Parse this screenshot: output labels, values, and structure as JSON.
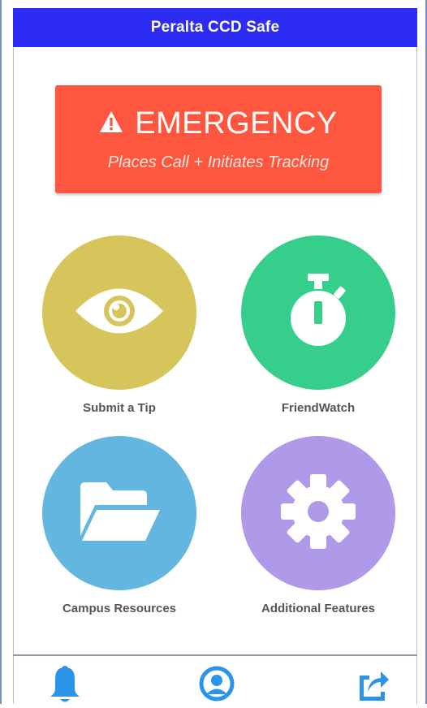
{
  "header": {
    "title": "Peralta CCD Safe"
  },
  "emergency": {
    "title": "EMERGENCY",
    "subtitle": "Places Call + Initiates Tracking",
    "icon": "warning-triangle-icon",
    "color": "#ff573f"
  },
  "tiles": [
    {
      "label": "Submit a Tip",
      "icon": "eye-icon",
      "color": "#d6c55a"
    },
    {
      "label": "FriendWatch",
      "icon": "stopwatch-icon",
      "color": "#35cf8b"
    },
    {
      "label": "Campus Resources",
      "icon": "folder-open-icon",
      "color": "#62b6e0"
    },
    {
      "label": "Additional Features",
      "icon": "gear-icon",
      "color": "#ae9ae8"
    }
  ],
  "bottom_nav": [
    {
      "icon": "bell-icon"
    },
    {
      "icon": "profile-icon"
    },
    {
      "icon": "share-icon"
    }
  ],
  "colors": {
    "header": "#2c2cf2",
    "nav_icons": "#2c94e8"
  }
}
